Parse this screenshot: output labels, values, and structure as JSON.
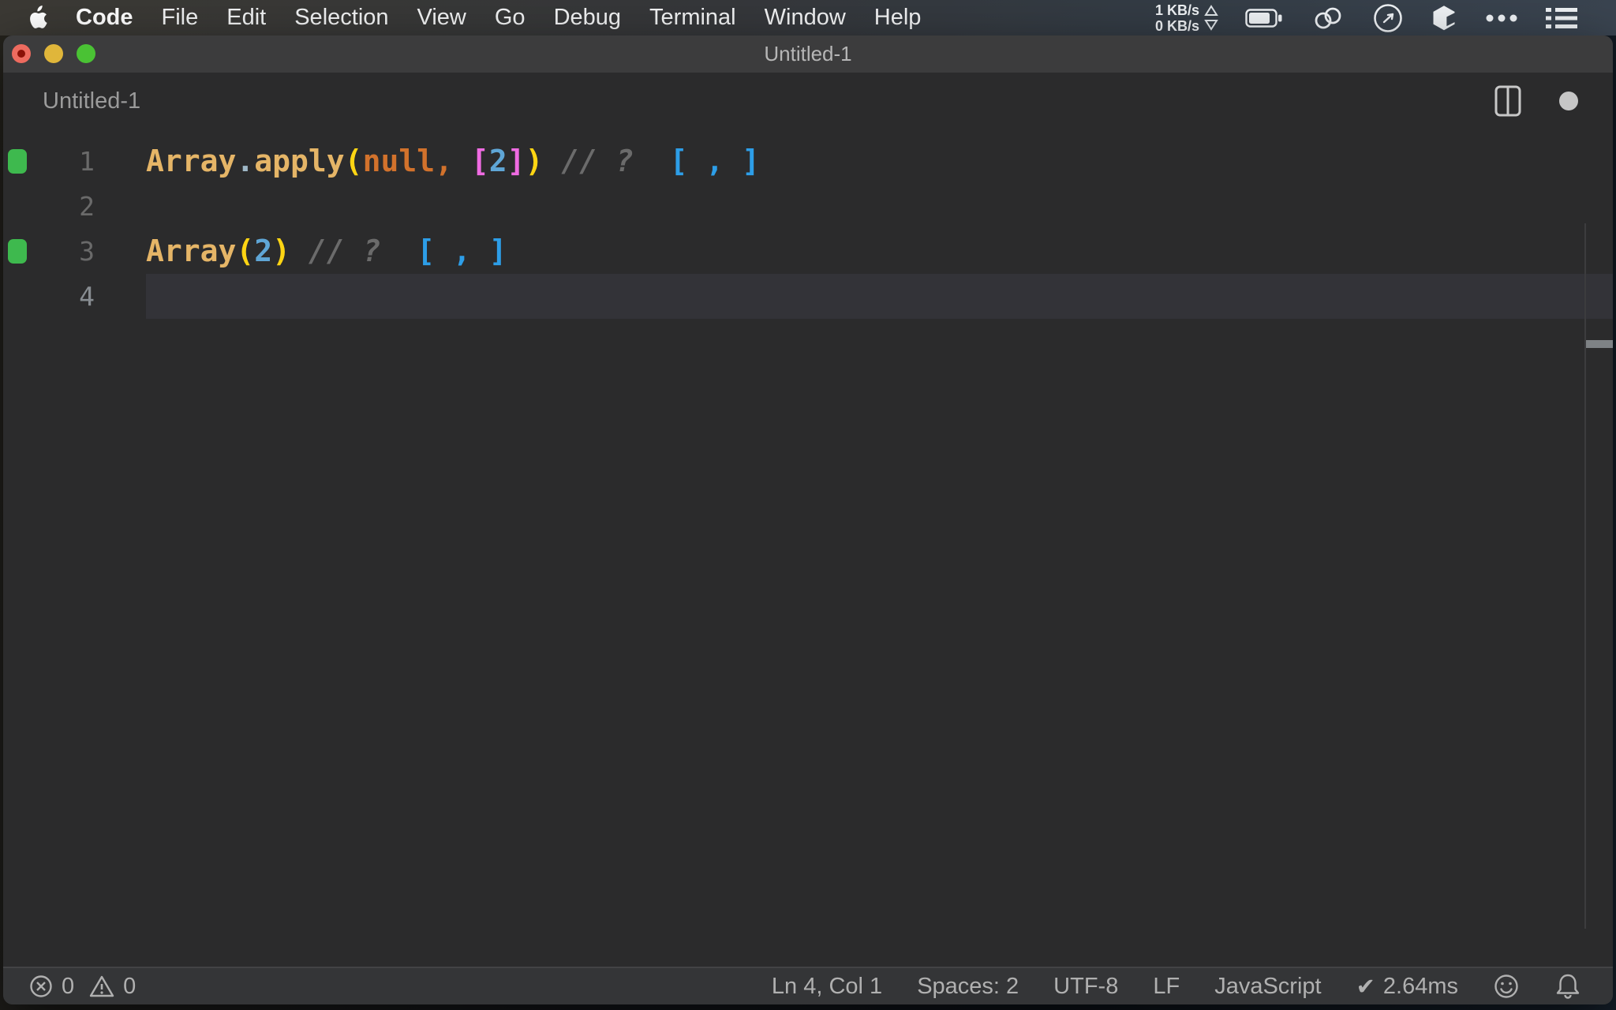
{
  "menu_bar": {
    "app_menu": "Code",
    "items": [
      "Code",
      "File",
      "Edit",
      "Selection",
      "View",
      "Go",
      "Debug",
      "Terminal",
      "Window",
      "Help"
    ],
    "net_up": "1 KB/s",
    "net_down": "0 KB/s",
    "status_icons": [
      "battery-icon",
      "linked-rings-icon",
      "clock-icon",
      "cube-icon",
      "ellipsis-icon",
      "list-icon"
    ]
  },
  "window": {
    "titlebar_title": "Untitled-1",
    "tab_label": "Untitled-1"
  },
  "editor": {
    "language_hint": "JavaScript",
    "lines": [
      {
        "num": "1",
        "marker": true,
        "active": false,
        "tokens": [
          {
            "t": "Array",
            "c": "ident"
          },
          {
            "t": ".",
            "c": "dot"
          },
          {
            "t": "apply",
            "c": "ident"
          },
          {
            "t": "(",
            "c": "paren1"
          },
          {
            "t": "null",
            "c": "keyword"
          },
          {
            "t": ",",
            "c": "punct"
          },
          {
            "t": " ",
            "c": "plain"
          },
          {
            "t": "[",
            "c": "bracket2"
          },
          {
            "t": "2",
            "c": "number"
          },
          {
            "t": "]",
            "c": "bracket2"
          },
          {
            "t": ")",
            "c": "paren1"
          },
          {
            "t": " ",
            "c": "plain"
          },
          {
            "t": "// ?",
            "c": "comment"
          },
          {
            "t": "  ",
            "c": "plain"
          },
          {
            "t": "[ , ]",
            "c": "output"
          }
        ]
      },
      {
        "num": "2",
        "marker": false,
        "active": false,
        "tokens": []
      },
      {
        "num": "3",
        "marker": true,
        "active": false,
        "tokens": [
          {
            "t": "Array",
            "c": "ident"
          },
          {
            "t": "(",
            "c": "paren1"
          },
          {
            "t": "2",
            "c": "number"
          },
          {
            "t": ")",
            "c": "paren1"
          },
          {
            "t": " ",
            "c": "plain"
          },
          {
            "t": "// ?",
            "c": "comment"
          },
          {
            "t": "  ",
            "c": "plain"
          },
          {
            "t": "[ , ]",
            "c": "output"
          }
        ]
      },
      {
        "num": "4",
        "marker": false,
        "active": true,
        "tokens": []
      }
    ]
  },
  "status_bar": {
    "errors": "0",
    "warnings": "0",
    "right_items": [
      {
        "key": "cursor-position",
        "label": "Ln 4, Col 1"
      },
      {
        "key": "indentation",
        "label": "Spaces: 2"
      },
      {
        "key": "encoding",
        "label": "UTF-8"
      },
      {
        "key": "eol",
        "label": "LF"
      },
      {
        "key": "language-mode",
        "label": "JavaScript"
      }
    ],
    "perf_check": "✔",
    "perf_value": "2.64ms"
  },
  "colors": {
    "menubar_left": "#3b3934",
    "menubar_right": "#3a4450",
    "titlebar": "#3c3c3d",
    "editor_bg": "#2b2b2c",
    "current_line": "#333338",
    "statusbar": "#343537",
    "quokka_marker_green": "#3eb94e",
    "token_ident": "#e5b567",
    "token_paren": "#ffd513",
    "token_null": "#d2722c",
    "token_bracket": "#ef6be2",
    "token_number": "#5fa6d6",
    "token_comment": "#6b6b6b",
    "quokka_output_blue": "#2d9ee8",
    "traffic_red": "#ed6b5f",
    "traffic_yellow": "#e0b63a",
    "traffic_green": "#4ac234"
  }
}
